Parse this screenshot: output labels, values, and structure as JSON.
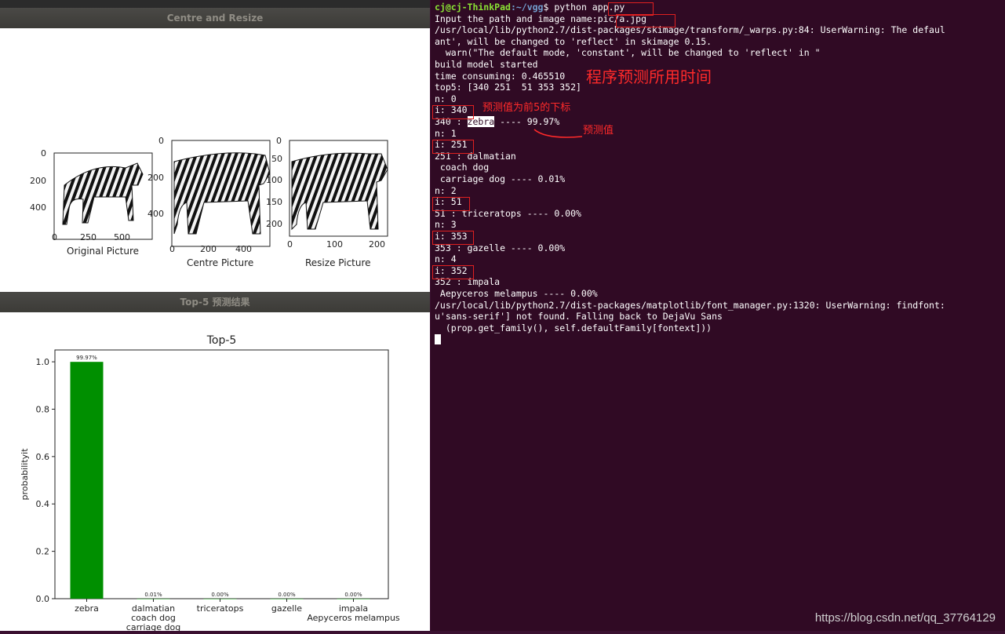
{
  "window_top": {
    "title": "Centre and Resize",
    "subplots": [
      {
        "xlabel": "Original Picture",
        "yticks": [
          "0",
          "200",
          "400"
        ],
        "xticks": [
          "0",
          "250",
          "500"
        ]
      },
      {
        "xlabel": "Centre Picture",
        "yticks": [
          "0",
          "200",
          "400"
        ],
        "xticks": [
          "0",
          "200",
          "400"
        ]
      },
      {
        "xlabel": "Resize Picture",
        "yticks": [
          "0",
          "50",
          "100",
          "150",
          "200"
        ],
        "xticks": [
          "0",
          "100",
          "200"
        ]
      }
    ]
  },
  "window_bottom": {
    "title": "Top-5 预测结果"
  },
  "chart_data": {
    "type": "bar",
    "title": "Top-5",
    "ylabel": "probabilityit",
    "xlabel": "",
    "categories": [
      "zebra",
      "dalmatian\ncoach dog\ncarriage dog",
      "triceratops",
      "gazelle",
      "impala\nAepyceros melampus"
    ],
    "category_lines": [
      [
        "zebra"
      ],
      [
        "dalmatian",
        "coach dog",
        "carriage dog"
      ],
      [
        "triceratops"
      ],
      [
        "gazelle"
      ],
      [
        "impala",
        "Aepyceros melampus"
      ]
    ],
    "values": [
      0.9997,
      0.0001,
      0.0,
      0.0,
      0.0
    ],
    "data_labels": [
      "99.97%",
      "0.01%",
      "0.00%",
      "0.00%",
      "0.00%"
    ],
    "ylim": [
      0,
      1.05
    ],
    "yticks": [
      "0.0",
      "0.2",
      "0.4",
      "0.6",
      "0.8",
      "1.0"
    ],
    "bar_color": "#008f00",
    "grid": false
  },
  "terminal": {
    "prompt_user": "cj@cj-ThinkPad",
    "prompt_path": ":~/vgg",
    "prompt_cmd": "$ python ",
    "prompt_arg": "app.py",
    "lines": [
      "Input the path and image name:",
      "/usr/local/lib/python2.7/dist-packages/skimage/transform/_warps.py:84: UserWarning: The defaul",
      "ant', will be changed to 'reflect' in skimage 0.15.",
      "  warn(\"The default mode, 'constant', will be changed to 'reflect' in \"",
      "build model started",
      "time consuming: 0.465510",
      "top5: [340 251  51 353 352]",
      "n: 0",
      "i: 340",
      "340 : ",
      "n: 1",
      "i: 251",
      "251 : dalmatian",
      " coach dog",
      " carriage dog ---- 0.01%",
      "n: 2",
      "i: 51",
      "51 : triceratops ---- 0.00%",
      "n: 3",
      "i: 353",
      "353 : gazelle ---- 0.00%",
      "n: 4",
      "i: 352",
      "352 : impala",
      " Aepyceros melampus ---- 0.00%",
      "/usr/local/lib/python2.7/dist-packages/matplotlib/font_manager.py:1320: UserWarning: findfont:",
      "u'sans-serif'] not found. Falling back to DejaVu Sans",
      "  (prop.get_family(), self.defaultFamily[fontext]))"
    ],
    "input_value": "pic/a.jpg",
    "zebra_selected": "zebra",
    "zebra_rest": " ---- 99.97%"
  },
  "annotations": {
    "time_note": "程序预测所用时间",
    "index_note": "预测值为前5的下标",
    "value_note": "预测值"
  },
  "watermark": "https://blog.csdn.net/qq_37764129"
}
